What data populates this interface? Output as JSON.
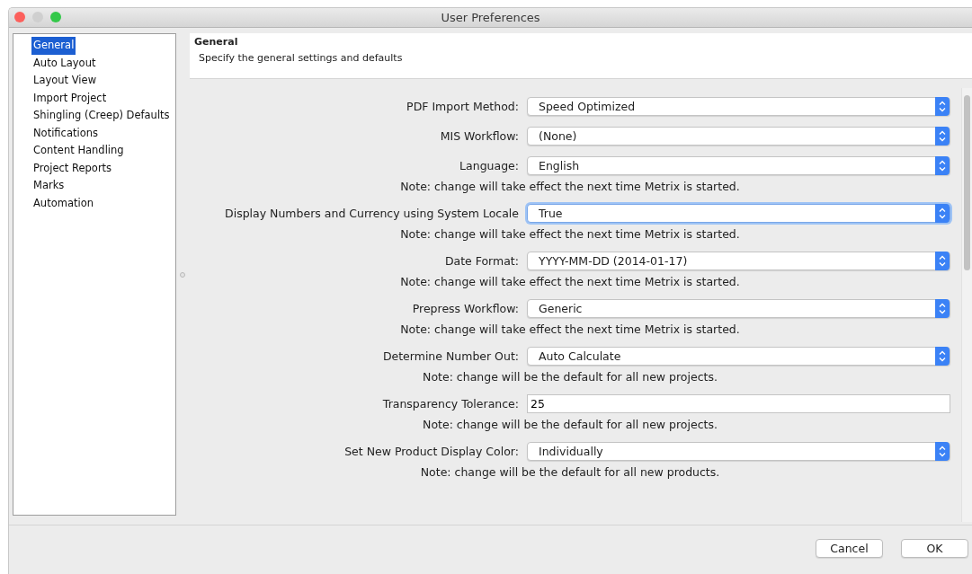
{
  "window": {
    "title": "User Preferences"
  },
  "sidebar": {
    "items": [
      {
        "label": "General",
        "selected": true
      },
      {
        "label": "Auto Layout",
        "selected": false
      },
      {
        "label": "Layout View",
        "selected": false
      },
      {
        "label": "Import Project",
        "selected": false
      },
      {
        "label": "Shingling (Creep) Defaults",
        "selected": false
      },
      {
        "label": "Notifications",
        "selected": false
      },
      {
        "label": "Content Handling",
        "selected": false
      },
      {
        "label": "Project Reports",
        "selected": false
      },
      {
        "label": "Marks",
        "selected": false
      },
      {
        "label": "Automation",
        "selected": false
      }
    ]
  },
  "header": {
    "title": "General",
    "description": "Specify the general settings and defaults"
  },
  "settings": [
    {
      "kind": "select",
      "label": "PDF Import Method:",
      "value": "Speed Optimized",
      "focused": false
    },
    {
      "kind": "select",
      "label": "MIS Workflow:",
      "value": "(None)",
      "focused": false
    },
    {
      "kind": "select",
      "label": "Language:",
      "value": "English",
      "focused": false,
      "note": "Note: change will take effect the next time Metrix is started."
    },
    {
      "kind": "select",
      "label": "Display Numbers and Currency using System Locale",
      "value": "True",
      "focused": true,
      "note": "Note: change will take effect the next time Metrix is started."
    },
    {
      "kind": "select",
      "label": "Date Format:",
      "value": "YYYY-MM-DD (2014-01-17)",
      "focused": false,
      "note": "Note: change will take effect the next time Metrix is started."
    },
    {
      "kind": "select",
      "label": "Prepress Workflow:",
      "value": "Generic",
      "focused": false,
      "note": "Note: change will take effect the next time Metrix is started."
    },
    {
      "kind": "select",
      "label": "Determine Number Out:",
      "value": "Auto Calculate",
      "focused": false,
      "note": "Note: change will be the default for all new projects."
    },
    {
      "kind": "text",
      "label": "Transparency Tolerance:",
      "value": "25",
      "focused": false,
      "note": "Note: change will be the default for all new projects."
    },
    {
      "kind": "select",
      "label": "Set New Product Display Color:",
      "value": "Individually",
      "focused": false,
      "note": "Note: change will be the default for all new products."
    }
  ],
  "buttons": [
    "Cancel",
    "OK"
  ]
}
